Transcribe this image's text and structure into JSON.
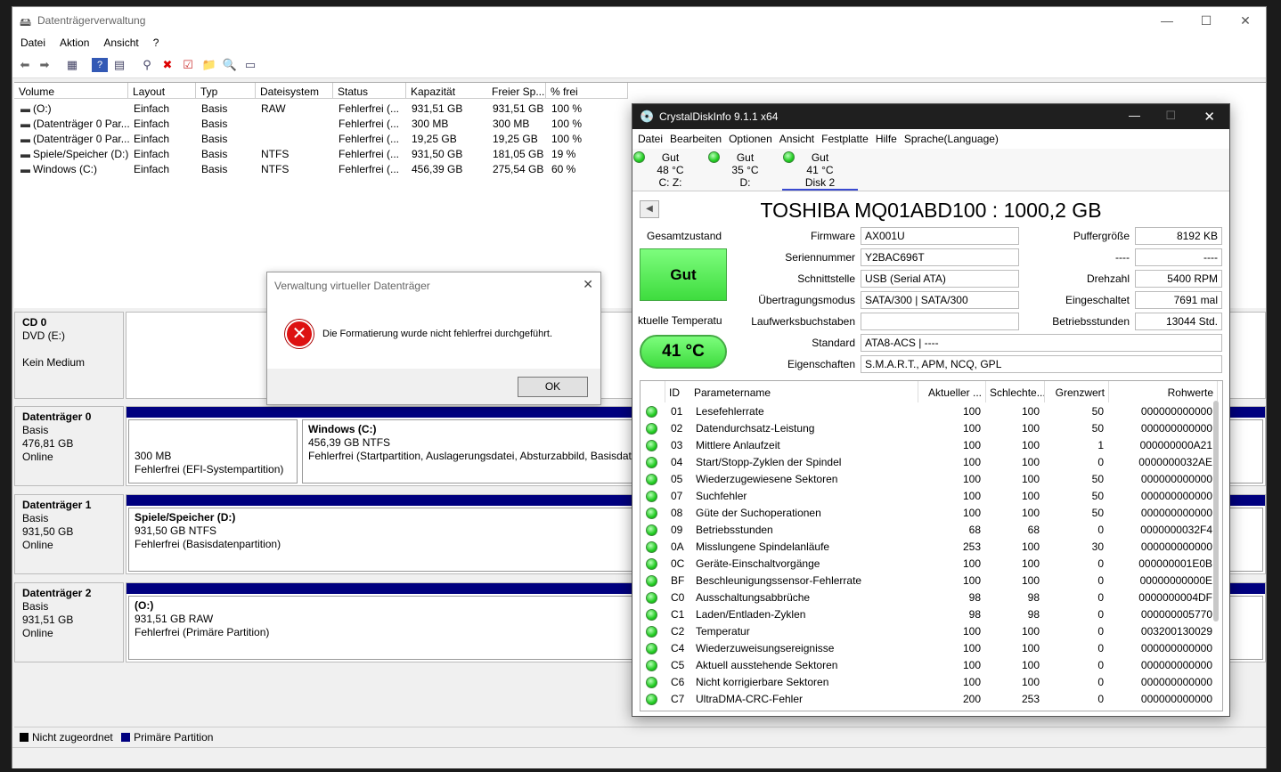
{
  "dm": {
    "title": "Datenträgerverwaltung",
    "menu": [
      "Datei",
      "Aktion",
      "Ansicht",
      "?"
    ],
    "columns": [
      "Volume",
      "Layout",
      "Typ",
      "Dateisystem",
      "Status",
      "Kapazität",
      "Freier Sp...",
      "% frei"
    ],
    "volumes": [
      [
        "(O:)",
        "Einfach",
        "Basis",
        "RAW",
        "Fehlerfrei (...",
        "931,51 GB",
        "931,51 GB",
        "100 %"
      ],
      [
        "(Datenträger 0 Par...",
        "Einfach",
        "Basis",
        "",
        "Fehlerfrei (...",
        "300 MB",
        "300 MB",
        "100 %"
      ],
      [
        "(Datenträger 0 Par...",
        "Einfach",
        "Basis",
        "",
        "Fehlerfrei (...",
        "19,25 GB",
        "19,25 GB",
        "100 %"
      ],
      [
        "Spiele/Speicher (D:)",
        "Einfach",
        "Basis",
        "NTFS",
        "Fehlerfrei (...",
        "931,50 GB",
        "181,05 GB",
        "19 %"
      ],
      [
        "Windows (C:)",
        "Einfach",
        "Basis",
        "NTFS",
        "Fehlerfrei (...",
        "456,39 GB",
        "275,54 GB",
        "60 %"
      ]
    ],
    "cd": {
      "name": "CD 0",
      "type": "DVD (E:)",
      "status": "Kein Medium"
    },
    "disk0": {
      "name": "Datenträger 0",
      "type": "Basis",
      "size": "476,81 GB",
      "status": "Online",
      "p1_size": "300 MB",
      "p1_status": "Fehlerfrei (EFI-Systempartition)",
      "p2_name": "Windows  (C:)",
      "p2_size": "456,39 GB NTFS",
      "p2_status": "Fehlerfrei (Startpartition, Auslagerungsdatei, Absturzabbild, Basisdaten"
    },
    "disk1": {
      "name": "Datenträger 1",
      "type": "Basis",
      "size": "931,50 GB",
      "status": "Online",
      "p_name": "Spiele/Speicher  (D:)",
      "p_size": "931,50 GB NTFS",
      "p_status": "Fehlerfrei (Basisdatenpartition)"
    },
    "disk2": {
      "name": "Datenträger 2",
      "type": "Basis",
      "size": "931,51 GB",
      "status": "Online",
      "p_name": "(O:)",
      "p_size": "931,51 GB RAW",
      "p_status": "Fehlerfrei (Primäre Partition)"
    },
    "legend": {
      "unallocated": "Nicht zugeordnet",
      "primary": "Primäre Partition"
    }
  },
  "msg": {
    "title": "Verwaltung virtueller Datenträger",
    "text": "Die Formatierung wurde nicht fehlerfrei durchgeführt.",
    "ok": "OK"
  },
  "cdi": {
    "title": "CrystalDiskInfo 9.1.1 x64",
    "menu": [
      "Datei",
      "Bearbeiten",
      "Optionen",
      "Ansicht",
      "Festplatte",
      "Hilfe",
      "Sprache(Language)"
    ],
    "drives": [
      {
        "status": "Gut",
        "temp": "48 °C",
        "label": "C: Z:"
      },
      {
        "status": "Gut",
        "temp": "35 °C",
        "label": "D:"
      },
      {
        "status": "Gut",
        "temp": "41 °C",
        "label": "Disk 2"
      }
    ],
    "model": "TOSHIBA MQ01ABD100 : 1000,2 GB",
    "health_label": "Gesamtzustand",
    "health": "Gut",
    "temp_label": "ktuelle Temperatu",
    "temp": "41 °C",
    "fields": {
      "firmware_l": "Firmware",
      "firmware": "AX001U",
      "serial_l": "Seriennummer",
      "serial": "Y2BAC696T",
      "iface_l": "Schnittstelle",
      "iface": "USB (Serial ATA)",
      "mode_l": "Übertragungsmodus",
      "mode": "SATA/300 | SATA/300",
      "letters_l": "Laufwerksbuchstaben",
      "letters": "",
      "std_l": "Standard",
      "std": "ATA8-ACS | ----",
      "feat_l": "Eigenschaften",
      "feat": "S.M.A.R.T., APM, NCQ, GPL",
      "buf_l": "Puffergröße",
      "buf": "8192 KB",
      "x_l": "----",
      "x": "----",
      "rpm_l": "Drehzahl",
      "rpm": "5400 RPM",
      "pon_l": "Eingeschaltet",
      "pon": "7691 mal",
      "hours_l": "Betriebsstunden",
      "hours": "13044 Std."
    },
    "smart_headers": [
      "ID",
      "Parametername",
      "Aktueller ...",
      "Schlechte...",
      "Grenzwert",
      "Rohwerte"
    ],
    "smart": [
      [
        "01",
        "Lesefehlerrate",
        "100",
        "100",
        "50",
        "000000000000"
      ],
      [
        "02",
        "Datendurchsatz-Leistung",
        "100",
        "100",
        "50",
        "000000000000"
      ],
      [
        "03",
        "Mittlere Anlaufzeit",
        "100",
        "100",
        "1",
        "000000000A21"
      ],
      [
        "04",
        "Start/Stopp-Zyklen der Spindel",
        "100",
        "100",
        "0",
        "0000000032AE"
      ],
      [
        "05",
        "Wiederzugewiesene Sektoren",
        "100",
        "100",
        "50",
        "000000000000"
      ],
      [
        "07",
        "Suchfehler",
        "100",
        "100",
        "50",
        "000000000000"
      ],
      [
        "08",
        "Güte der Suchoperationen",
        "100",
        "100",
        "50",
        "000000000000"
      ],
      [
        "09",
        "Betriebsstunden",
        "68",
        "68",
        "0",
        "0000000032F4"
      ],
      [
        "0A",
        "Misslungene Spindelanläufe",
        "253",
        "100",
        "30",
        "000000000000"
      ],
      [
        "0C",
        "Geräte-Einschaltvorgänge",
        "100",
        "100",
        "0",
        "000000001E0B"
      ],
      [
        "BF",
        "Beschleunigungssensor-Fehlerrate",
        "100",
        "100",
        "0",
        "00000000000E"
      ],
      [
        "C0",
        "Ausschaltungsabbrüche",
        "98",
        "98",
        "0",
        "0000000004DF"
      ],
      [
        "C1",
        "Laden/Entladen-Zyklen",
        "98",
        "98",
        "0",
        "000000005770"
      ],
      [
        "C2",
        "Temperatur",
        "100",
        "100",
        "0",
        "003200130029"
      ],
      [
        "C4",
        "Wiederzuweisungsereignisse",
        "100",
        "100",
        "0",
        "000000000000"
      ],
      [
        "C5",
        "Aktuell ausstehende Sektoren",
        "100",
        "100",
        "0",
        "000000000000"
      ],
      [
        "C6",
        "Nicht korrigierbare Sektoren",
        "100",
        "100",
        "0",
        "000000000000"
      ],
      [
        "C7",
        "UltraDMA-CRC-Fehler",
        "200",
        "253",
        "0",
        "000000000000"
      ]
    ]
  }
}
